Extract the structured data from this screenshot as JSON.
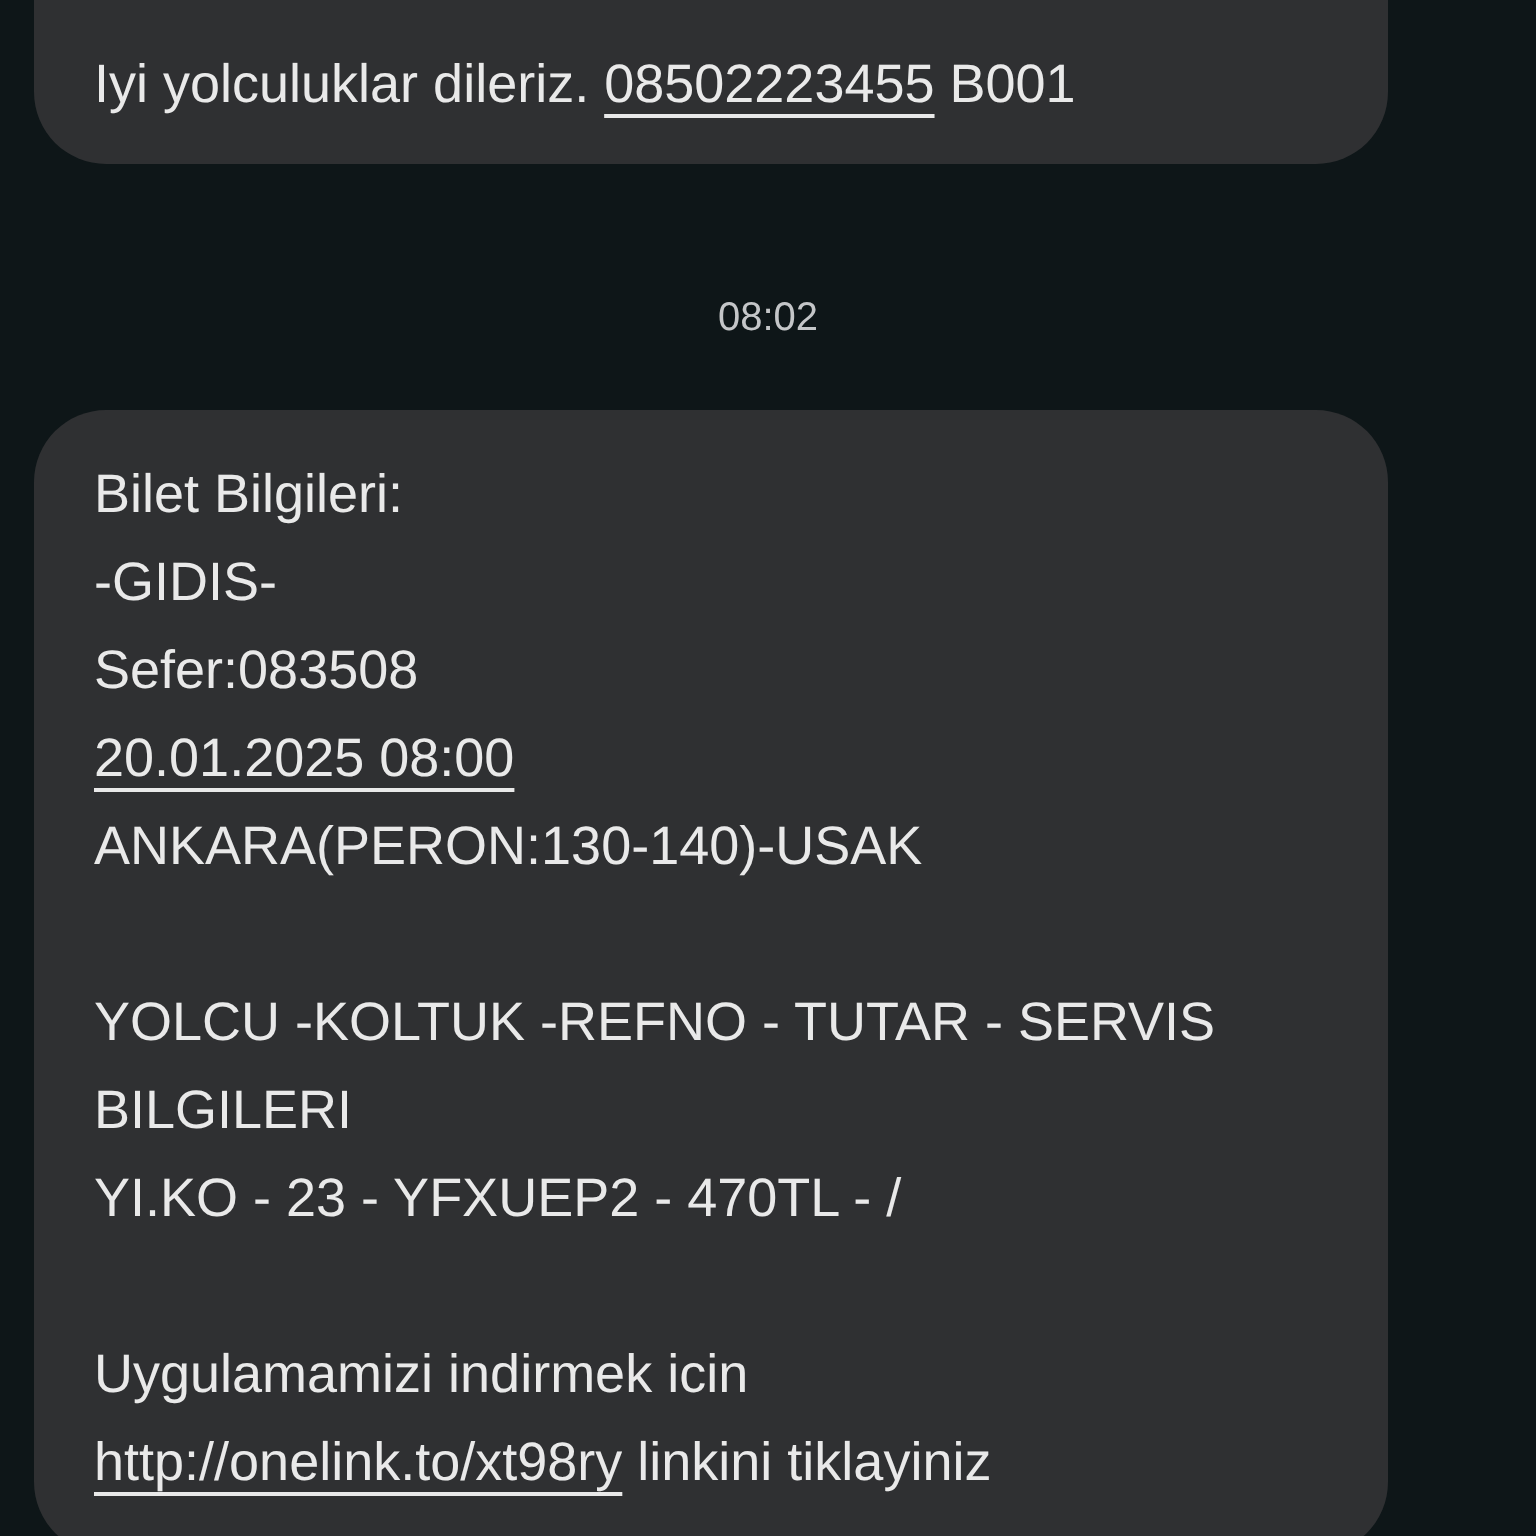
{
  "messages": [
    {
      "paragraphs": [
        [
          [
            {
              "kind": "text",
              "text": "Iyi yolculuklar dileriz. "
            },
            {
              "kind": "link",
              "text": "08502223455"
            },
            {
              "kind": "text",
              "text": " B001"
            }
          ]
        ]
      ]
    },
    {
      "time": "08:02",
      "paragraphs": [
        [
          [
            {
              "kind": "text",
              "text": "Bilet Bilgileri:"
            }
          ],
          [
            {
              "kind": "text",
              "text": "-GIDIS-"
            }
          ],
          [
            {
              "kind": "text",
              "text": "Sefer:083508"
            }
          ],
          [
            {
              "kind": "link",
              "text": "20.01.2025 08:00"
            }
          ],
          [
            {
              "kind": "text",
              "text": "ANKARA(PERON:130-140)-USAK"
            }
          ]
        ],
        [
          [
            {
              "kind": "text",
              "text": "YOLCU -KOLTUK -REFNO - TUTAR - SERVIS BILGILERI"
            }
          ],
          [
            {
              "kind": "text",
              "text": "YI.KO - 23 - YFXUEP2 - 470TL - /"
            }
          ]
        ],
        [
          [
            {
              "kind": "text",
              "text": "Uygulamamizi indirmek icin"
            }
          ],
          [
            {
              "kind": "link",
              "text": "http://onelink.to/xt98ry"
            },
            {
              "kind": "text",
              "text": " linkini tiklayiniz"
            }
          ]
        ]
      ]
    }
  ]
}
